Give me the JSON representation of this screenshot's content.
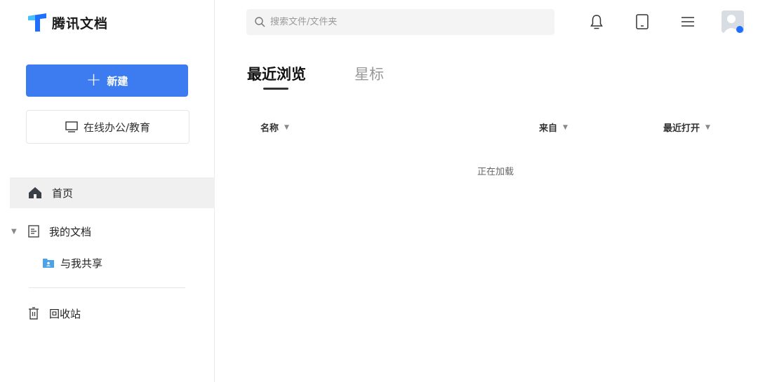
{
  "app": {
    "name": "腾讯文档"
  },
  "sidebar": {
    "new_button_label": "新建",
    "office_button_label": "在线办公/教育",
    "nav": {
      "home": "首页",
      "my_docs": "我的文档",
      "shared": "与我共享",
      "trash": "回收站"
    }
  },
  "search": {
    "placeholder": "搜索文件/文件夹"
  },
  "tabs": {
    "recent": "最近浏览",
    "starred": "星标"
  },
  "columns": {
    "name": "名称",
    "from": "来自",
    "opened": "最近打开"
  },
  "status": {
    "loading": "正在加载"
  },
  "colors": {
    "accent": "#3c7cf0",
    "logo_blue": "#1e6fff",
    "folder_blue": "#4aa3ea"
  }
}
